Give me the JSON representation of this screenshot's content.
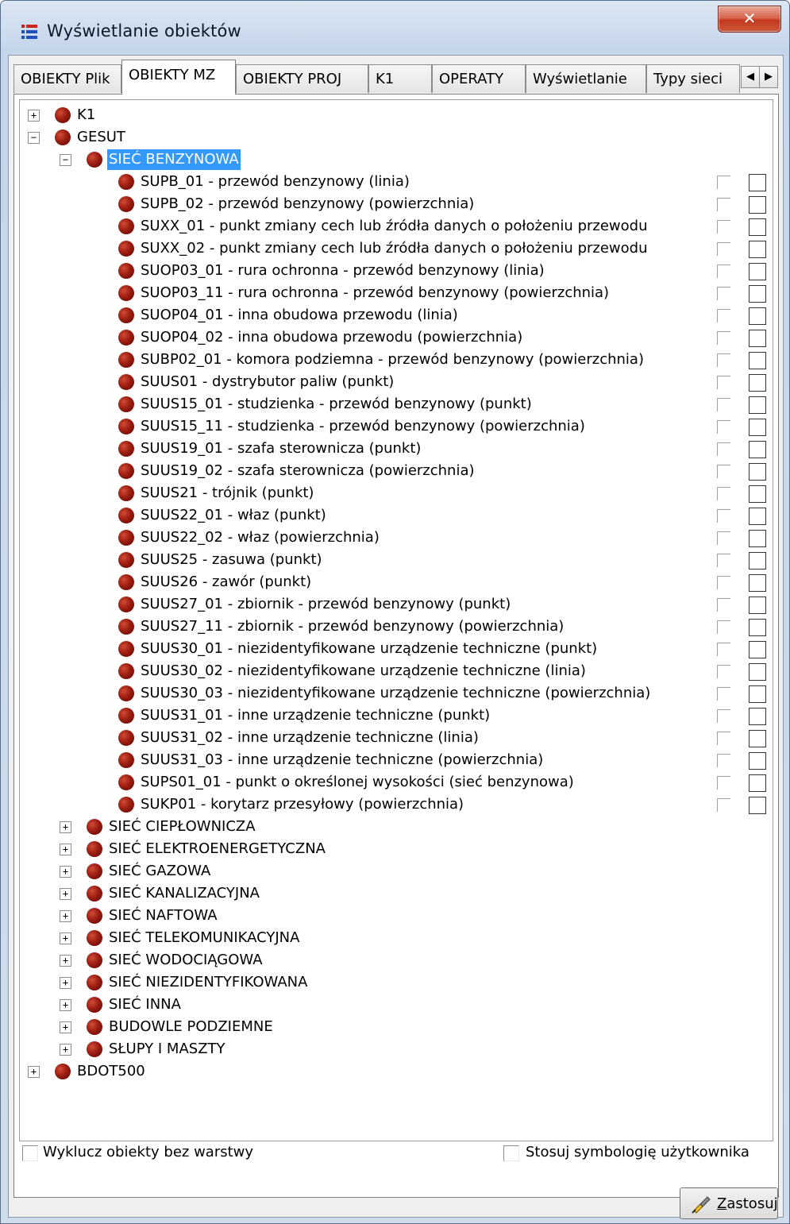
{
  "window": {
    "title": "Wyświetlanie obiektów",
    "close_glyph": "✕",
    "icon": "app-grid-icon"
  },
  "tabs": [
    {
      "label": "OBIEKTY Plik",
      "active": false
    },
    {
      "label": "OBIEKTY MZ",
      "active": true
    },
    {
      "label": "OBIEKTY PROJ",
      "active": false
    },
    {
      "label": "K1",
      "active": false
    },
    {
      "label": "OPERATY",
      "active": false
    },
    {
      "label": "Wyświetlanie",
      "active": false
    },
    {
      "label": "Typy sieci",
      "active": false
    }
  ],
  "tab_scroll": {
    "left": "◀",
    "right": "▶"
  },
  "tree": {
    "roots": [
      {
        "label": "K1",
        "expander": "+"
      },
      {
        "label": "GESUT",
        "expander": "−"
      },
      {
        "label": "BDOT500",
        "expander": "+"
      }
    ],
    "selected_group": {
      "label": "SIEĆ BENZYNOWA",
      "expander": "−"
    },
    "items": [
      "SUPB_01 - przewód benzynowy (linia)",
      "SUPB_02 - przewód benzynowy (powierzchnia)",
      "SUXX_01 - punkt zmiany cech lub źródła danych o położeniu przewodu",
      "SUXX_02 - punkt zmiany cech lub źródła danych o położeniu przewodu",
      "SUOP03_01 - rura ochronna - przewód benzynowy (linia)",
      "SUOP03_11 - rura ochronna - przewód benzynowy (powierzchnia)",
      "SUOP04_01 - inna obudowa przewodu (linia)",
      "SUOP04_02 - inna obudowa przewodu (powierzchnia)",
      "SUBP02_01 - komora podziemna - przewód benzynowy (powierzchnia)",
      "SUUS01 - dystrybutor paliw (punkt)",
      "SUUS15_01 - studzienka - przewód benzynowy (punkt)",
      "SUUS15_11 - studzienka - przewód benzynowy (powierzchnia)",
      "SUUS19_01 - szafa sterownicza (punkt)",
      "SUUS19_02 - szafa sterownicza (powierzchnia)",
      "SUUS21 - trójnik (punkt)",
      "SUUS22_01 - właz (punkt)",
      "SUUS22_02 - właz (powierzchnia)",
      "SUUS25 - zasuwa (punkt)",
      "SUUS26 - zawór (punkt)",
      "SUUS27_01 - zbiornik - przewód benzynowy (punkt)",
      "SUUS27_11 - zbiornik - przewód benzynowy (powierzchnia)",
      "SUUS30_01 - niezidentyfikowane urządzenie techniczne (punkt)",
      "SUUS30_02 - niezidentyfikowane urządzenie techniczne (linia)",
      "SUUS30_03 - niezidentyfikowane urządzenie techniczne (powierzchnia)",
      "SUUS31_01 - inne urządzenie techniczne (punkt)",
      "SUUS31_02 - inne urządzenie techniczne (linia)",
      "SUUS31_03 - inne urządzenie techniczne (powierzchnia)",
      "SUPS01_01 - punkt o określonej wysokości (sieć benzynowa)",
      "SUKP01 - korytarz przesyłowy (powierzchnia)"
    ],
    "groups": [
      "SIEĆ CIEPŁOWNICZA",
      "SIEĆ ELEKTROENERGETYCZNA",
      "SIEĆ GAZOWA",
      "SIEĆ KANALIZACYJNA",
      "SIEĆ NAFTOWA",
      "SIEĆ TELEKOMUNIKACYJNA",
      "SIEĆ WODOCIĄGOWA",
      "SIEĆ NIEZIDENTYFIKOWANA",
      "SIEĆ INNA",
      "BUDOWLE PODZIEMNE",
      "SŁUPY I MASZTY"
    ],
    "collapsed_glyph": "+"
  },
  "options": {
    "exclude_label": "Wyklucz obiekty bez warstwy",
    "exclude_checked": false,
    "symbology_label": "Stosuj symbologię użytkownika",
    "symbology_checked": false
  },
  "apply_button": {
    "mnemonic": "Z",
    "rest": "astosuj",
    "icon": "brush-icon"
  },
  "colors": {
    "selection": "#3399ff",
    "bullet": "#9b1c11",
    "close": "#c1381e"
  }
}
